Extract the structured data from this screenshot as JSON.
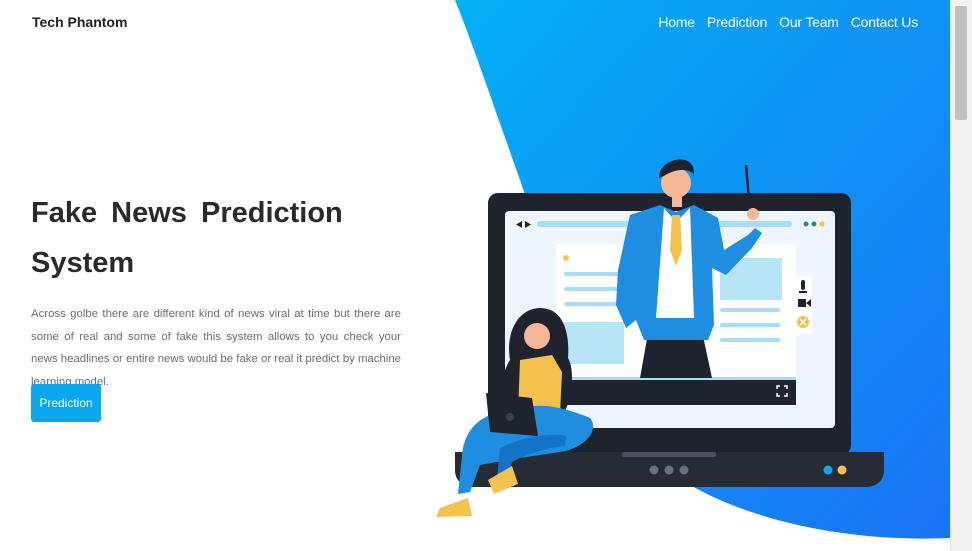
{
  "brand": "Tech Phantom",
  "nav": {
    "home": "Home",
    "prediction": "Prediction",
    "team": "Our Team",
    "contact": "Contact Us"
  },
  "hero": {
    "title": "Fake News Prediction System",
    "description": "Across golbe there are different kind of news viral at time but there are some of real and some of fake this system allows to you check your news headlines or entire news would be fake or real it predict by machine learning model.",
    "button": "Prediction"
  },
  "colors": {
    "accent": "#08a7ef",
    "gradient_start": "#03b0f5",
    "gradient_end": "#1a73f5"
  },
  "icons": [
    "play-back-icon",
    "play-forward-icon",
    "microphone-icon",
    "video-icon",
    "close-icon",
    "fullscreen-icon"
  ]
}
